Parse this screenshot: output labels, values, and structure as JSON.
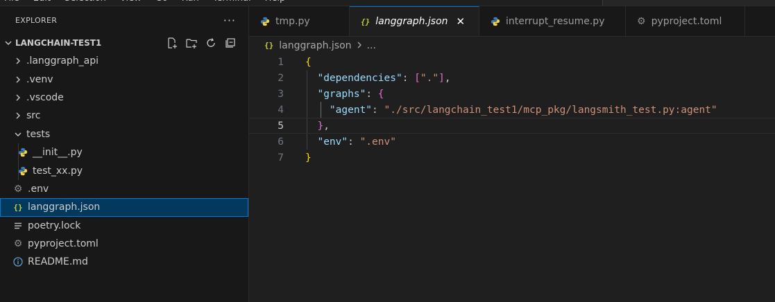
{
  "menubar": [
    "File",
    "Edit",
    "Selection",
    "View",
    "Go",
    "Run",
    "Terminal",
    "Help"
  ],
  "sidebar": {
    "title": "EXPLORER",
    "section": "LANGCHAIN-TEST1",
    "tree": [
      {
        "label": ".langgraph_api",
        "kind": "folder",
        "expanded": false,
        "level": 0
      },
      {
        "label": ".venv",
        "kind": "folder",
        "expanded": false,
        "level": 0
      },
      {
        "label": ".vscode",
        "kind": "folder",
        "expanded": false,
        "level": 0
      },
      {
        "label": "src",
        "kind": "folder",
        "expanded": false,
        "level": 0
      },
      {
        "label": "tests",
        "kind": "folder",
        "expanded": true,
        "level": 0
      },
      {
        "label": "__init__.py",
        "kind": "python",
        "level": 1
      },
      {
        "label": "test_xx.py",
        "kind": "python",
        "level": 1
      },
      {
        "label": ".env",
        "kind": "gear",
        "level": 0
      },
      {
        "label": "langgraph.json",
        "kind": "json",
        "level": 0,
        "selected": true
      },
      {
        "label": "poetry.lock",
        "kind": "lines",
        "level": 0
      },
      {
        "label": "pyproject.toml",
        "kind": "gear",
        "level": 0
      },
      {
        "label": "README.md",
        "kind": "info",
        "level": 0
      }
    ]
  },
  "tabs": [
    {
      "label": "tmp.py",
      "icon": "python",
      "active": false
    },
    {
      "label": "langgraph.json",
      "icon": "json",
      "active": true
    },
    {
      "label": "interrupt_resume.py",
      "icon": "python",
      "active": false
    },
    {
      "label": "pyproject.toml",
      "icon": "gear",
      "active": false
    }
  ],
  "breadcrumb": {
    "file": "langgraph.json",
    "rest": "..."
  },
  "editor": {
    "current_line": 5,
    "line_numbers": [
      "1",
      "2",
      "3",
      "4",
      "5",
      "6",
      "7"
    ],
    "lines": [
      [
        {
          "t": "{",
          "c": "b1"
        }
      ],
      [
        {
          "t": "  \"dependencies\"",
          "c": "k"
        },
        {
          "t": ": ",
          "c": "p"
        },
        {
          "t": "[",
          "c": "b2"
        },
        {
          "t": "\".\"",
          "c": "s"
        },
        {
          "t": "]",
          "c": "b2"
        },
        {
          "t": ",",
          "c": "p"
        }
      ],
      [
        {
          "t": "  \"graphs\"",
          "c": "k"
        },
        {
          "t": ": ",
          "c": "p"
        },
        {
          "t": "{",
          "c": "b2"
        }
      ],
      [
        {
          "t": "    \"agent\"",
          "c": "k"
        },
        {
          "t": ": ",
          "c": "p"
        },
        {
          "t": "\"./src/langchain_test1/mcp_pkg/langsmith_test.py:agent\"",
          "c": "s"
        }
      ],
      [
        {
          "t": "  ",
          "c": "p"
        },
        {
          "t": "}",
          "c": "b2"
        },
        {
          "t": ",",
          "c": "p"
        }
      ],
      [
        {
          "t": "  \"env\"",
          "c": "k"
        },
        {
          "t": ": ",
          "c": "p"
        },
        {
          "t": "\".env\"",
          "c": "s"
        }
      ],
      [
        {
          "t": "}",
          "c": "b1"
        }
      ]
    ]
  },
  "colors": {
    "accent": "#0078d4",
    "selection": "#04395e",
    "json_icon": "#cbcb41",
    "python_blue": "#3e7ab6",
    "python_yellow": "#f5d34a"
  }
}
